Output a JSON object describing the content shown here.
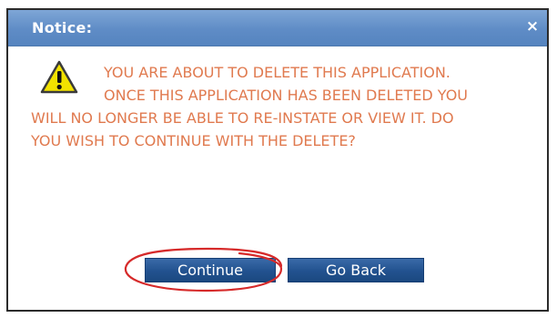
{
  "dialog": {
    "title": "Notice:",
    "close_glyph": "×",
    "icon": "warning-icon",
    "message_lines": [
      "YOU ARE ABOUT TO DELETE THIS APPLICATION.",
      "ONCE THIS APPLICATION HAS BEEN DELETED YOU",
      "WILL NO LONGER BE ABLE TO RE-INSTATE OR VIEW IT. DO",
      "YOU WISH TO CONTINUE WITH THE DELETE?"
    ],
    "buttons": {
      "continue": "Continue",
      "go_back": "Go Back"
    }
  },
  "colors": {
    "titlebar": "#5f8cc6",
    "message_text": "#e07a4f",
    "button": "#22528f",
    "highlight_ring": "#d62a2a",
    "warning_yellow": "#f2e200"
  }
}
